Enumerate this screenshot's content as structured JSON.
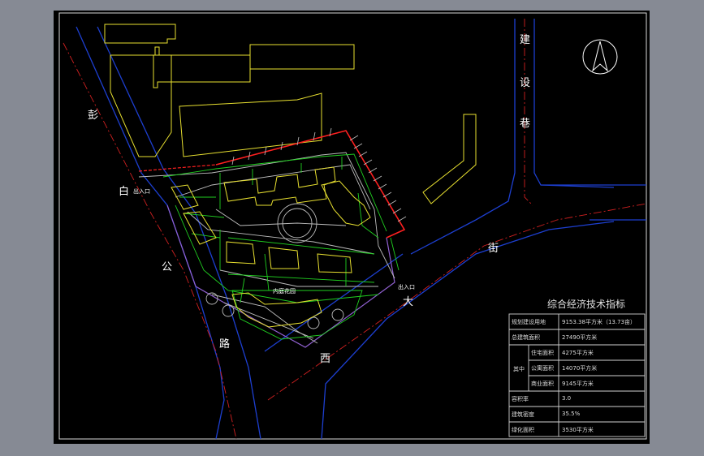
{
  "roads": {
    "jianshe_1": "建",
    "jianshe_2": "设",
    "jianshe_3": "巷",
    "peng": "彭",
    "bai": "白",
    "gong": "公",
    "lu": "路",
    "xi": "西",
    "da": "大",
    "jie": "街"
  },
  "site": {
    "entrance_west": "出入口",
    "entrance_east": "出入口",
    "inner_label": "内庭花园"
  },
  "table": {
    "title": "综合经济技术指标",
    "rows": [
      {
        "label": "规划建设用地",
        "value": "9153.38平方米（13.73亩）"
      },
      {
        "label": "总建筑面积",
        "value": "27490平方米"
      },
      {
        "label": "住宅面积",
        "value": "4275平方米"
      },
      {
        "label": "公寓面积",
        "value": "14070平方米"
      },
      {
        "label": "商业面积",
        "value": "9145平方米"
      },
      {
        "label": "容积率",
        "value": "3.0"
      },
      {
        "label": "建筑密度",
        "value": "35.5%"
      },
      {
        "label": "绿化面积",
        "value": "3530平方米"
      }
    ],
    "group_label": "其中"
  },
  "colors": {
    "frame_bg": "#000000",
    "outer_bg": "#868a94",
    "road": "#1d3fd0",
    "road_center": "#d02020",
    "site_boundary": "#ff2020",
    "building": "#e8e030",
    "green_line": "#20d020",
    "grey_line": "#c0c0c0"
  }
}
